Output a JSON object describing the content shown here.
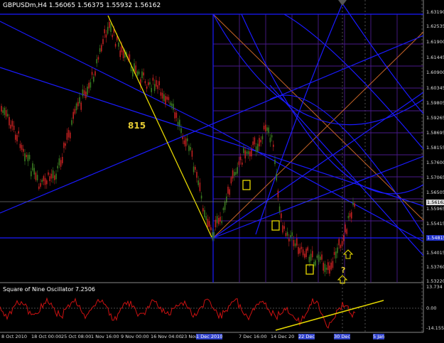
{
  "window": {
    "symbol_header": "GBPUSDm,H4  1.56065 1.56375 1.55932 1.56162"
  },
  "indicator": {
    "title": "Square of Nine Oscillator 7.2506",
    "levels": [
      "13.734",
      "0.00",
      "-14.155"
    ]
  },
  "annotations": {
    "label_815": "815",
    "question_mark": "?"
  },
  "price_axis": {
    "labels": [
      "1.63190",
      "1.62535",
      "1.61900",
      "1.61445",
      "1.60900",
      "1.60345",
      "1.59805",
      "1.59265",
      "1.58695",
      "1.58155",
      "1.57600",
      "1.57065",
      "1.56505",
      "1.55965",
      "1.55415",
      "1.54815",
      "1.54015",
      "1.53760",
      "1.53220"
    ],
    "current_price": "1.56162",
    "blue_level": "1.54815"
  },
  "time_axis": {
    "labels": [
      "8 Oct 2010",
      "18 Oct 00:00",
      "25 Oct 08:00",
      "1 Nov 16:00",
      "9 Nov 00:00",
      "16 Nov 04:00",
      "23 Nov",
      "1 Dec 2010",
      "7 Dec 16:00",
      "14 Dec 20",
      "22 Dec",
      "30 Dec",
      "5 Jan"
    ],
    "highlighted": [
      "1 Dec 2010",
      "22 Dec",
      "30 Dec",
      "5 Jan"
    ]
  },
  "colors": {
    "background": "#000000",
    "up_candle": "#3a7a20",
    "down_candle": "#c02020",
    "blue_line": "#1a1aff",
    "orange_line": "#c86428",
    "yellow_line": "#e6d800",
    "oscillator": "#cc1111"
  }
}
